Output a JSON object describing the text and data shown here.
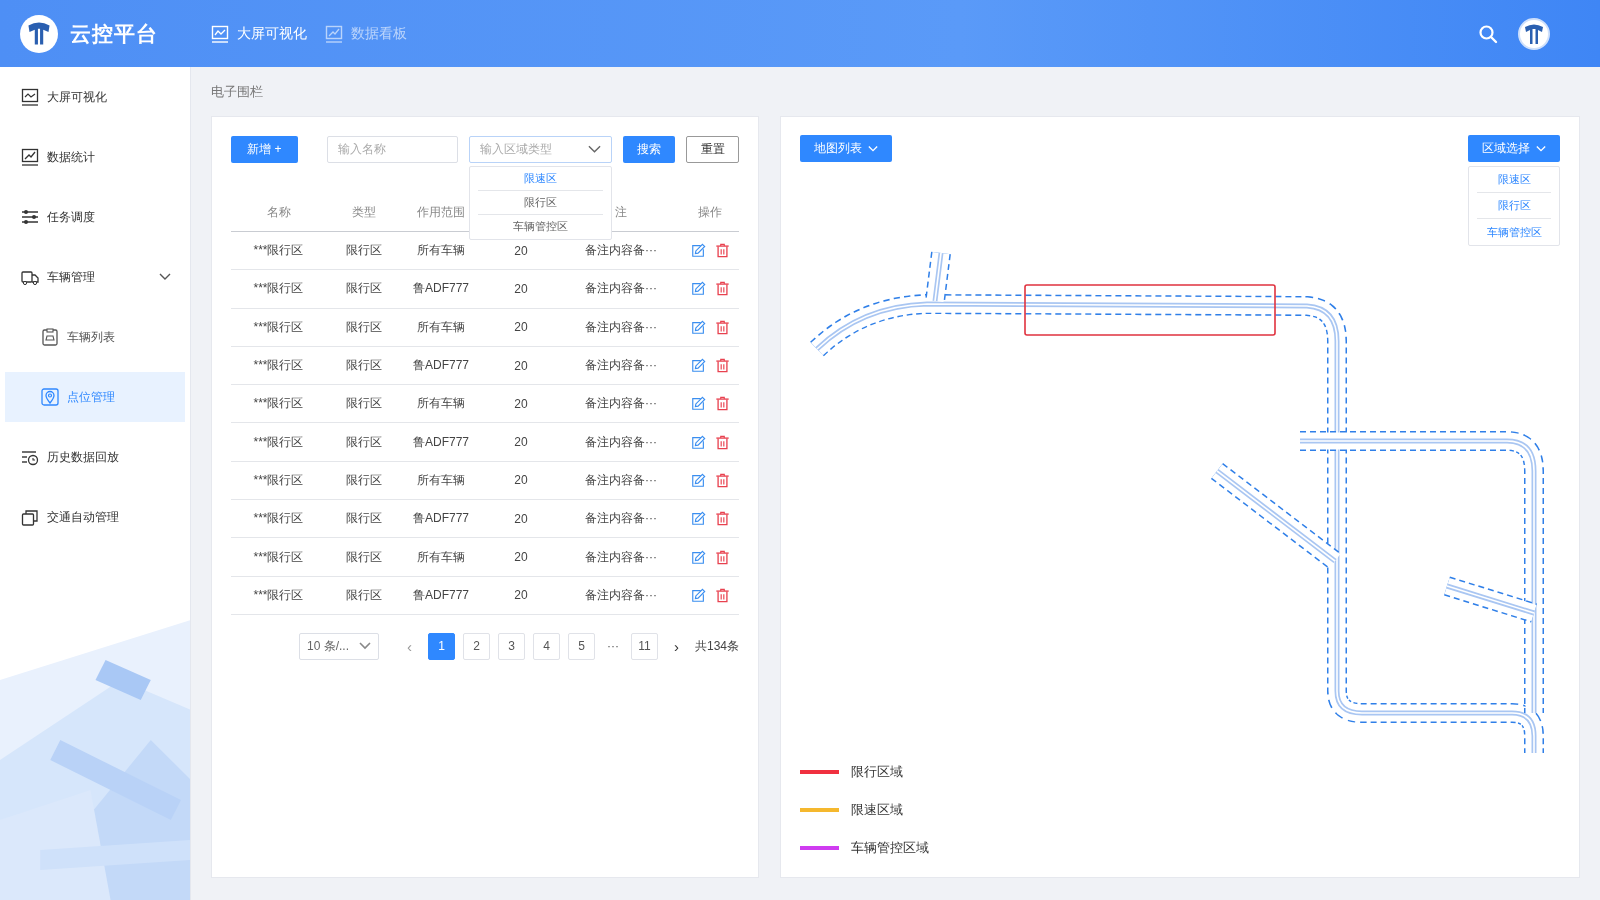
{
  "header": {
    "title": "云控平台",
    "nav": [
      {
        "label": "大屏可视化",
        "selected": true
      },
      {
        "label": "数据看板",
        "selected": false
      }
    ]
  },
  "sidebar": {
    "items": [
      {
        "label": "大屏可视化",
        "selected": false
      },
      {
        "label": "数据统计",
        "selected": false
      },
      {
        "label": "任务调度",
        "selected": false
      },
      {
        "label": "车辆管理",
        "selected": false,
        "expanded": true,
        "children": [
          {
            "label": "车辆列表",
            "selected": false
          },
          {
            "label": "点位管理",
            "selected": true
          }
        ]
      },
      {
        "label": "历史数据回放",
        "selected": false
      },
      {
        "label": "交通自动管理",
        "selected": false
      }
    ]
  },
  "breadcrumb": "电子围栏",
  "toolbar": {
    "add_button": "新增 +",
    "name_field": {
      "placeholder": "输入名称"
    },
    "type_select": {
      "placeholder": "输入区域类型",
      "expanded": true,
      "options": [
        {
          "label": "限速区",
          "selected": true
        },
        {
          "label": "限行区",
          "selected": false
        },
        {
          "label": "车辆管控区",
          "selected": false
        }
      ]
    },
    "search_button": "搜索",
    "reset_button": "重置"
  },
  "table": {
    "columns": [
      {
        "label": "名称"
      },
      {
        "label": "类型"
      },
      {
        "label": "作用范围"
      },
      {},
      {
        "label": "注"
      },
      {
        "label": "操作"
      }
    ],
    "rows": [
      [
        "***限行区",
        "限行区",
        "所有车辆",
        "20",
        "备注内容备···"
      ],
      [
        "***限行区",
        "限行区",
        "鲁ADF777",
        "20",
        "备注内容备···"
      ],
      [
        "***限行区",
        "限行区",
        "所有车辆",
        "20",
        "备注内容备···"
      ],
      [
        "***限行区",
        "限行区",
        "鲁ADF777",
        "20",
        "备注内容备···"
      ],
      [
        "***限行区",
        "限行区",
        "所有车辆",
        "20",
        "备注内容备···"
      ],
      [
        "***限行区",
        "限行区",
        "鲁ADF777",
        "20",
        "备注内容备···"
      ],
      [
        "***限行区",
        "限行区",
        "所有车辆",
        "20",
        "备注内容备···"
      ],
      [
        "***限行区",
        "限行区",
        "鲁ADF777",
        "20",
        "备注内容备···"
      ],
      [
        "***限行区",
        "限行区",
        "所有车辆",
        "20",
        "备注内容备···"
      ],
      [
        "***限行区",
        "限行区",
        "鲁ADF777",
        "20",
        "备注内容备···"
      ]
    ]
  },
  "pagination": {
    "page_size": "10 条/...",
    "prev": "‹",
    "pages": [
      {
        "label": "1",
        "selected": true
      },
      {
        "label": "2",
        "selected": false
      },
      {
        "label": "3",
        "selected": false
      },
      {
        "label": "4",
        "selected": false
      },
      {
        "label": "5",
        "selected": false
      }
    ],
    "ellipsis": "···",
    "last_page": {
      "label": "11",
      "selected": false
    },
    "next": "›",
    "total": "共134条"
  },
  "map_panel": {
    "map_list_button": "地图列表",
    "region_button": "区域选择",
    "region_options": [
      "限速区",
      "限行区",
      "车辆管控区"
    ],
    "legend": [
      {
        "label": "限行区域",
        "color": "#f0303f"
      },
      {
        "label": "限速区域",
        "color": "#f5b82e"
      },
      {
        "label": "车辆管控区域",
        "color": "#cf3cf0"
      }
    ]
  }
}
